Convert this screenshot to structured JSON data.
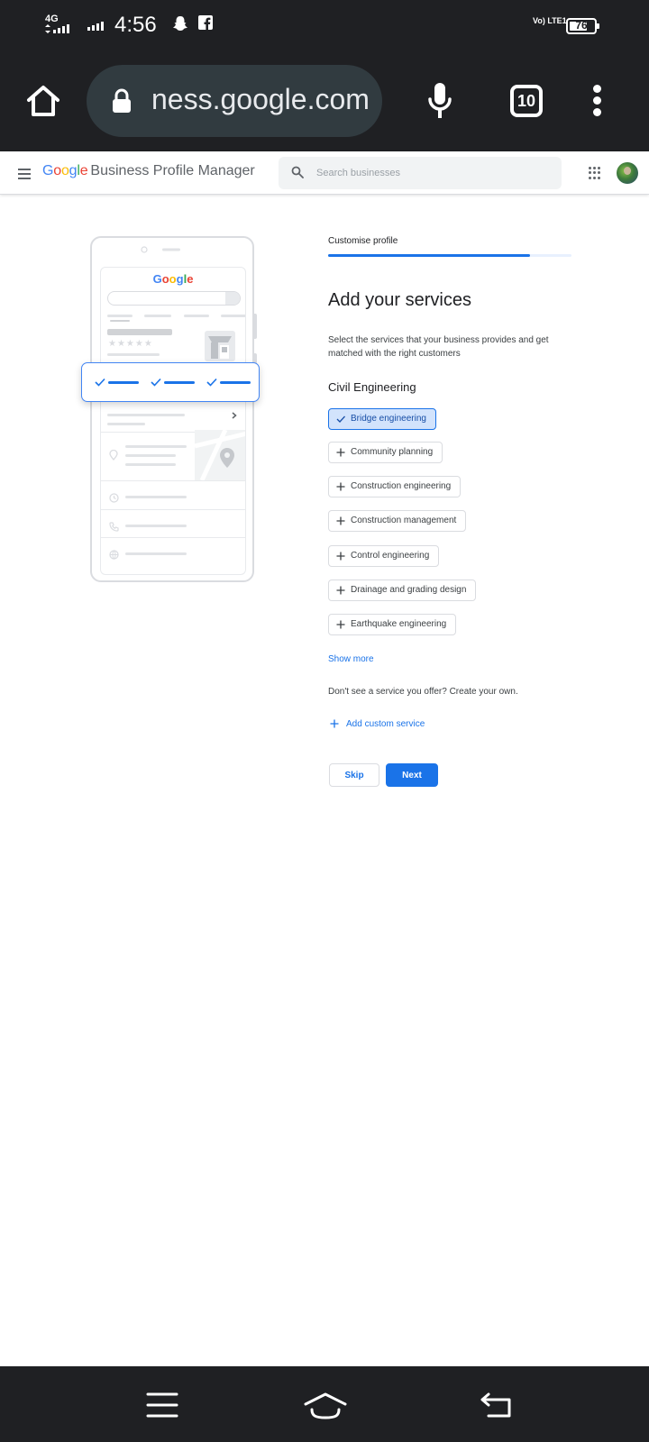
{
  "status_bar": {
    "network": "4G",
    "time": "4:56",
    "volte": "Vo) LTE1",
    "battery_level": "76",
    "battery_fraction": 0.76,
    "icons": [
      "signal-icon",
      "snapchat-icon",
      "facebook-icon"
    ]
  },
  "browser": {
    "url": "ness.google.com",
    "tab_count": "10",
    "icons": [
      "home-icon",
      "lock-icon",
      "mic-icon",
      "tabs-icon",
      "more-vert-icon"
    ]
  },
  "header": {
    "logo": "Google",
    "product_name": "Business Profile Manager",
    "search_placeholder": "Search businesses",
    "search_value": "",
    "icons": [
      "menu-icon",
      "search-icon",
      "apps-icon",
      "avatar"
    ]
  },
  "illustration": {
    "logo": "Google"
  },
  "form": {
    "step_label": "Customise profile",
    "progress_fraction": 0.83,
    "title": "Add your services",
    "description": "Select the services that your business provides and get matched with the right customers",
    "category": "Civil Engineering",
    "services": [
      {
        "label": "Bridge engineering",
        "selected": true
      },
      {
        "label": "Community planning",
        "selected": false
      },
      {
        "label": "Construction engineering",
        "selected": false
      },
      {
        "label": "Construction management",
        "selected": false
      },
      {
        "label": "Control engineering",
        "selected": false
      },
      {
        "label": "Drainage and grading design",
        "selected": false
      },
      {
        "label": "Earthquake engineering",
        "selected": false
      }
    ],
    "show_more": "Show more",
    "custom_note": "Don't see a service you offer? Create your own.",
    "add_custom": "Add custom service",
    "skip": "Skip",
    "next": "Next"
  },
  "colors": {
    "accent": "#1a73e8",
    "selected_chip_bg": "#d2e3fc",
    "system_bar": "#1f2023"
  }
}
